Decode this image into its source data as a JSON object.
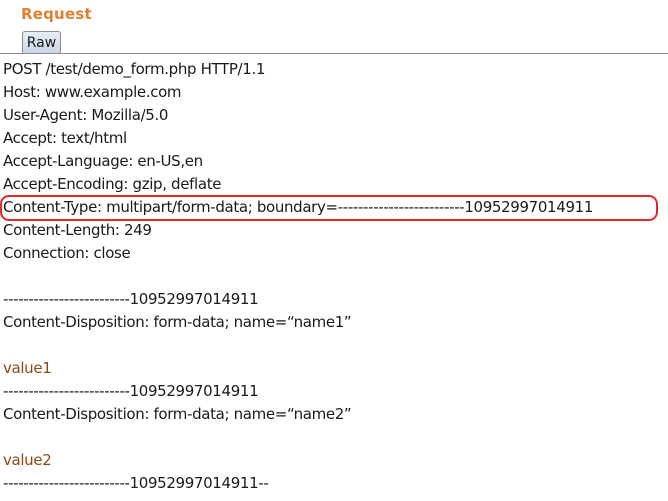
{
  "panel": {
    "title": "Request",
    "tab_label": "Raw"
  },
  "request_lines": [
    {
      "text": "POST /test/demo_form.php HTTP/1.1",
      "kind": "header"
    },
    {
      "text": "Host: www.example.com",
      "kind": "header"
    },
    {
      "text": "User-Agent: Mozilla/5.0",
      "kind": "header"
    },
    {
      "text": "Accept: text/html",
      "kind": "header"
    },
    {
      "text": "Accept-Language: en-US,en",
      "kind": "header"
    },
    {
      "text": "Accept-Encoding: gzip, deflate",
      "kind": "header"
    },
    {
      "text": "Content-Type: multipart/form-data; boundary=-------------------------10952997014911",
      "kind": "header"
    },
    {
      "text": "Content-Length: 249",
      "kind": "header"
    },
    {
      "text": "Connection: close",
      "kind": "header"
    },
    {
      "text": "",
      "kind": "blank"
    },
    {
      "text": "-------------------------10952997014911",
      "kind": "boundary"
    },
    {
      "text": "Content-Disposition: form-data; name=“name1”",
      "kind": "header"
    },
    {
      "text": "",
      "kind": "blank"
    },
    {
      "text": "value1",
      "kind": "value"
    },
    {
      "text": "-------------------------10952997014911",
      "kind": "boundary"
    },
    {
      "text": "Content-Disposition: form-data; name=“name2”",
      "kind": "header"
    },
    {
      "text": "",
      "kind": "blank"
    },
    {
      "text": "value2",
      "kind": "value"
    },
    {
      "text": "-------------------------10952997014911--",
      "kind": "boundary"
    }
  ],
  "highlight": {
    "line_index": 6,
    "color": "#e0282f"
  },
  "colors": {
    "title": "#e2802f",
    "text": "#1a1a1a",
    "value": "#8a4a12"
  }
}
